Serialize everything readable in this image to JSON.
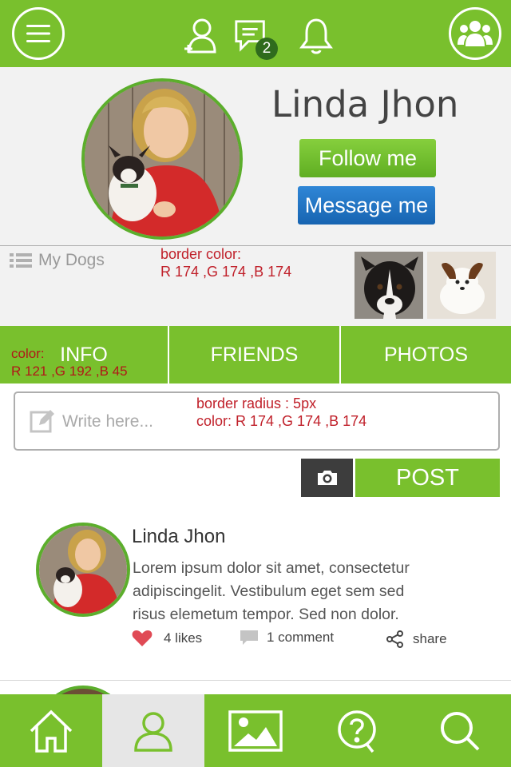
{
  "header": {
    "menu_icon": "hamburger-icon",
    "add_friend_icon": "add-user-icon",
    "messages_icon": "chat-icon",
    "messages_badge": "2",
    "notifications_icon": "bell-icon",
    "groups_icon": "group-icon"
  },
  "profile": {
    "name": "Linda Jhon",
    "follow_label": "Follow me",
    "message_label": "Message me"
  },
  "dogs": {
    "label": "My Dogs",
    "thumbnails": [
      "border-collie-photo",
      "papillon-puppy-photo"
    ]
  },
  "annotations": {
    "dogs_border_line1": "border color:",
    "dogs_border_line2": "R 174 ,G 174 ,B 174",
    "tab_color_line1": "color:",
    "tab_color_line2": "R 121 ,G 192 ,B 45",
    "composer_line1": "border radius : 5px",
    "composer_line2": "color: R 174 ,G 174 ,B 174"
  },
  "tabs": [
    {
      "label": "INFO"
    },
    {
      "label": "FRIENDS"
    },
    {
      "label": "PHOTOS"
    }
  ],
  "composer": {
    "placeholder": "Write here...",
    "post_label": "POST"
  },
  "feed": {
    "author": "Linda Jhon",
    "body": "Lorem ipsum dolor sit amet, consectetur adipiscingelit. Vestibulum eget sem sed risus elemetum tempor. Sed non dolor.",
    "likes": "4 likes",
    "comments": "1 comment",
    "share": "share"
  },
  "bottom_nav": [
    {
      "icon": "home-icon"
    },
    {
      "icon": "profile-icon"
    },
    {
      "icon": "gallery-icon"
    },
    {
      "icon": "help-icon"
    },
    {
      "icon": "search-icon"
    }
  ],
  "colors": {
    "brand_green": "#79c02d",
    "message_blue": "#1d6fc0",
    "annotation_red": "#c0202a",
    "border_gray": "#aeaeae"
  }
}
